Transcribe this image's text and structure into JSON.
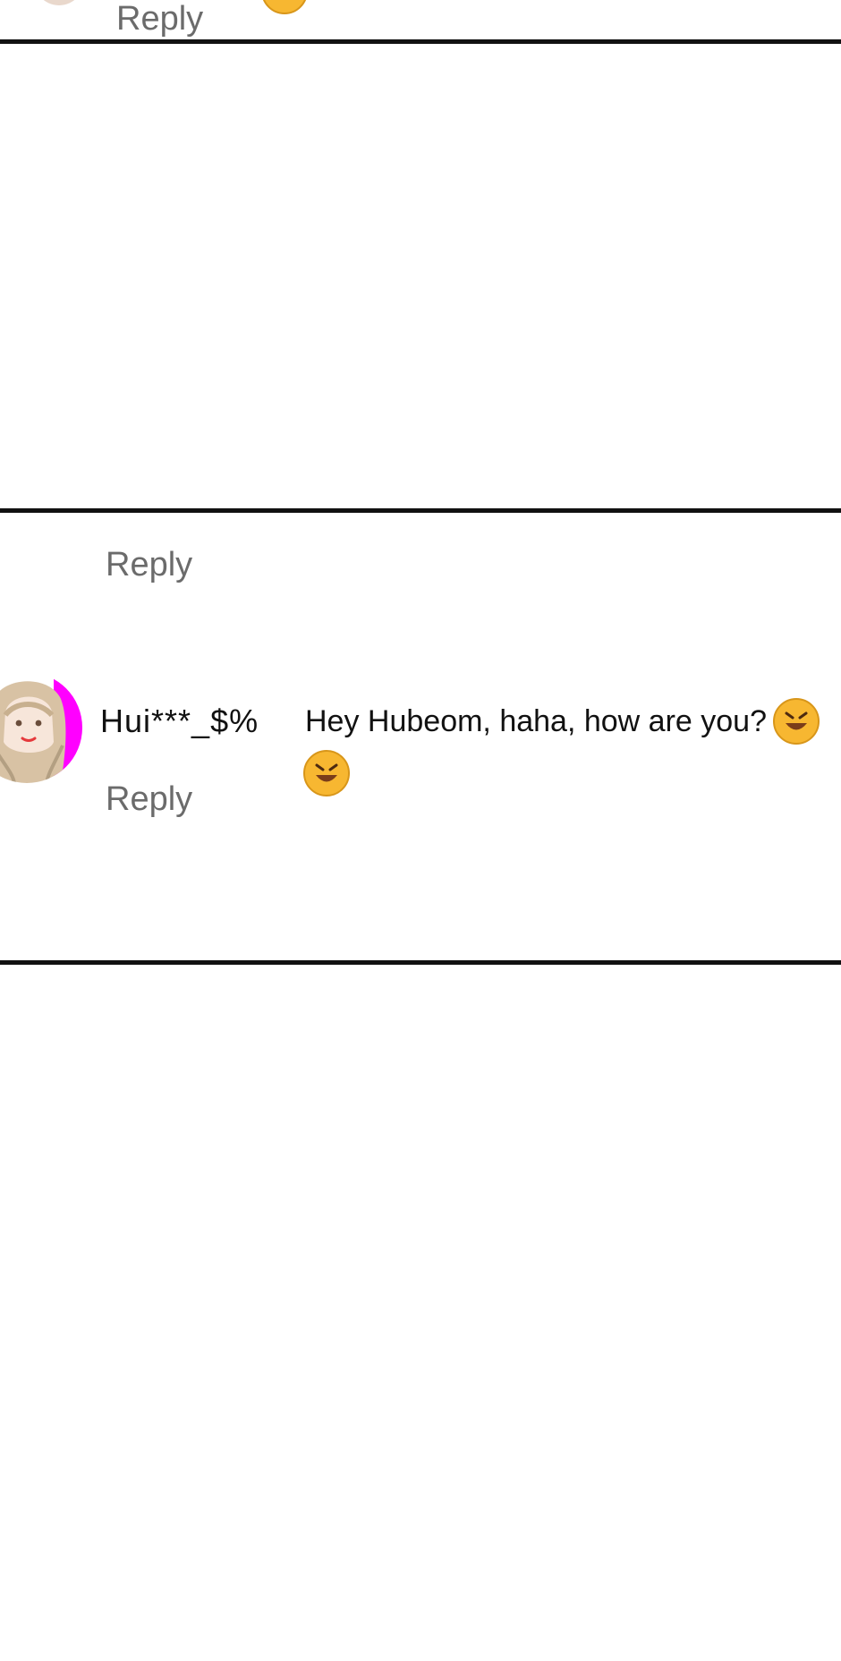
{
  "comments": [
    {
      "reply_label": "Reply",
      "emoji": "rolling-on-floor-laughing"
    },
    {
      "reply_label": "Reply"
    },
    {
      "username": "Hui***_$%",
      "text": "Hey Hubeom, haha, how are you?",
      "reply_label": "Reply",
      "emojis": [
        "rolling-on-floor-laughing",
        "rolling-on-floor-laughing"
      ],
      "avatar": "woman-with-long-blonde-hair"
    }
  ],
  "colors": {
    "divider": "#111111",
    "reply_text": "#6b6b6b",
    "username_text": "#111111",
    "avatar_accent": "#ff00ff",
    "emoji_yellow": "#f7b731"
  }
}
